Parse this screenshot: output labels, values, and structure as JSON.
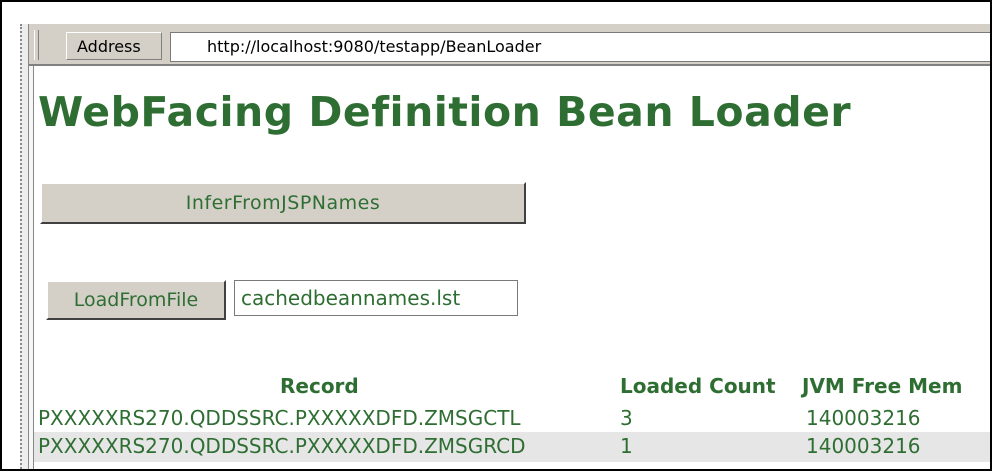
{
  "address_bar": {
    "label": "Address",
    "url": "http://localhost:9080/testapp/BeanLoader"
  },
  "page": {
    "title": "WebFacing Definition Bean Loader",
    "infer_button": "InferFromJSPNames",
    "load_button": "LoadFromFile",
    "file_input_value": "cachedbeannames.lst"
  },
  "table": {
    "headers": [
      "Record",
      "Loaded Count",
      "JVM Free Mem"
    ],
    "rows": [
      {
        "record": "PXXXXXRS270.QDDSSRC.PXXXXXDFD.ZMSGCTL",
        "count": "3",
        "mem": "140003216"
      },
      {
        "record": "PXXXXXRS270.QDDSSRC.PXXXXXDFD.ZMSGRCD",
        "count": "1",
        "mem": "140003216"
      }
    ]
  }
}
